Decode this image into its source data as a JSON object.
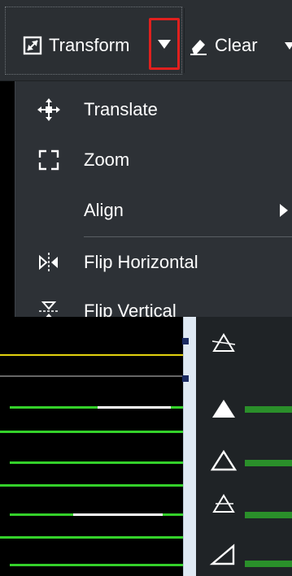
{
  "toolbar": {
    "transform_label": "Transform",
    "clear_label": "Clear",
    "transform_icon": "resize-arrow-icon",
    "clear_icon": "eraser-icon",
    "dropdown_icon": "chevron-down-icon",
    "highlight_color": "#e0201e"
  },
  "menu": {
    "items": [
      {
        "label": "Translate",
        "icon": "move-arrows-icon"
      },
      {
        "label": "Zoom",
        "icon": "zoom-corners-icon"
      },
      {
        "label": "Align",
        "icon": "",
        "has_submenu": true
      },
      {
        "label": "Flip Horizontal",
        "icon": "flip-horizontal-icon"
      },
      {
        "label": "Flip Vertical",
        "icon": "flip-vertical-icon"
      }
    ]
  },
  "colors": {
    "toolbar_bg": "#2b2f33",
    "menu_bg": "#2d3136",
    "accent_green": "#34d12a",
    "accent_yellow": "#e3d30f",
    "scrollbar_bg": "#dfe9f3"
  }
}
